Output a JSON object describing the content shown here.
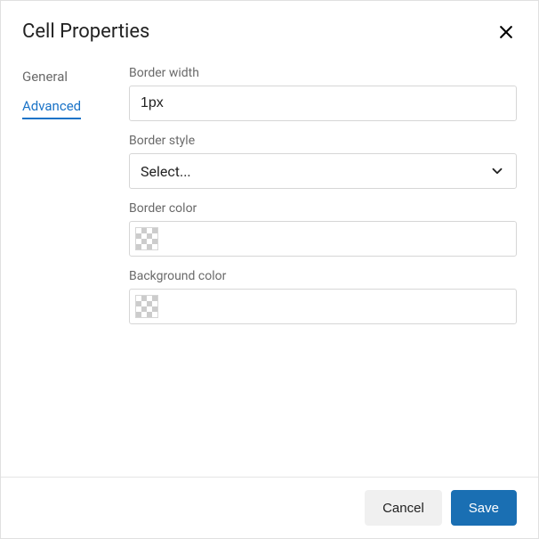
{
  "dialog": {
    "title": "Cell Properties",
    "tabs": {
      "general": "General",
      "advanced": "Advanced"
    },
    "fields": {
      "border_width": {
        "label": "Border width",
        "value": "1px"
      },
      "border_style": {
        "label": "Border style",
        "placeholder": "Select..."
      },
      "border_color": {
        "label": "Border color"
      },
      "background_color": {
        "label": "Background color"
      }
    },
    "buttons": {
      "cancel": "Cancel",
      "save": "Save"
    }
  }
}
